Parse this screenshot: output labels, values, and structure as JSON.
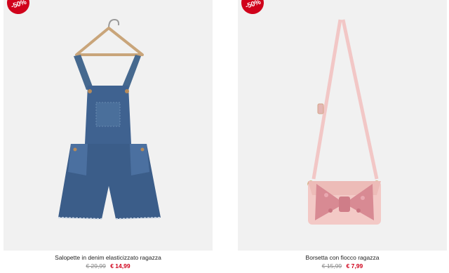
{
  "products": [
    {
      "discount_badge": "-50%",
      "name": "Salopette in denim elasticizzato ragazza",
      "old_price": "€ 29,99",
      "new_price": "€ 14,99",
      "image_alt": "denim-overalls-on-hanger"
    },
    {
      "discount_badge": "-50%",
      "name": "Borsetta con fiocco ragazza",
      "old_price": "€ 15,99",
      "new_price": "€ 7,99",
      "image_alt": "pink-bow-shoulder-bag"
    }
  ],
  "colors": {
    "badge": "#d0021b",
    "sale_price": "#d0021b",
    "image_background": "#f1f1f1"
  }
}
